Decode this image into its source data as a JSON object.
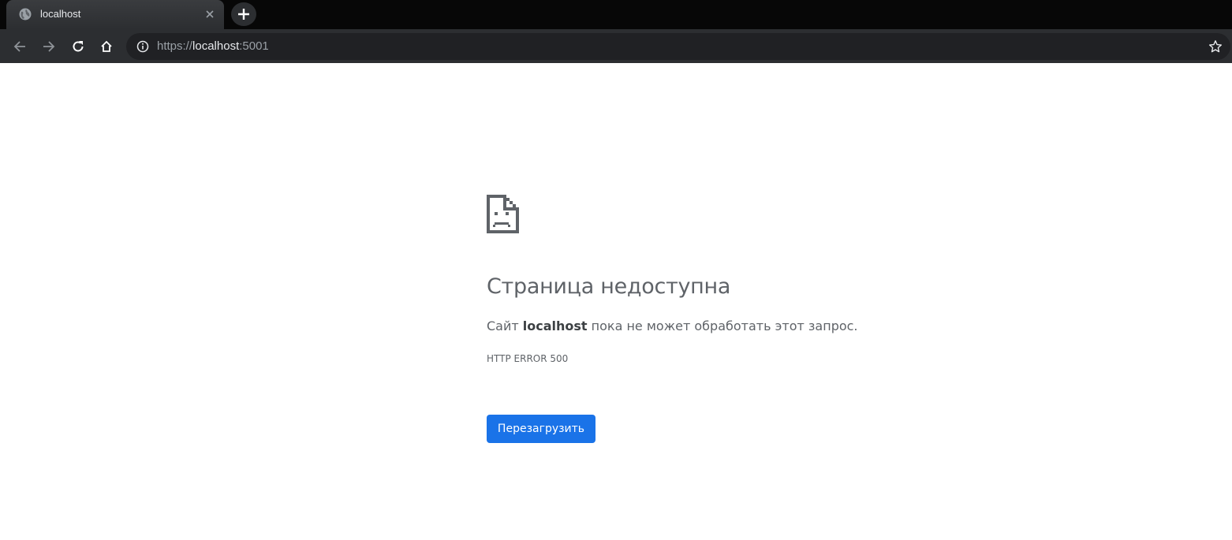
{
  "browser": {
    "tab": {
      "title": "localhost",
      "favicon": "globe-icon",
      "close": "close-icon"
    },
    "new_tab": "plus-icon",
    "toolbar": {
      "back": "arrow-left-icon",
      "forward": "arrow-right-icon",
      "reload": "reload-icon",
      "home": "home-icon"
    },
    "omnibox": {
      "security_icon": "info-icon",
      "url_scheme": "https://",
      "url_host": "localhost",
      "url_port": ":5001",
      "bookmark_icon": "star-outline-icon"
    }
  },
  "error_page": {
    "icon": "sad-page-icon",
    "heading": "Страница недоступна",
    "message_prefix": "Сайт ",
    "message_host": "localhost",
    "message_suffix": " пока не может обработать этот запрос.",
    "error_code": "HTTP ERROR 500",
    "reload_button_label": "Перезагрузить"
  },
  "colors": {
    "tab_strip_bg": "#070707",
    "toolbar_bg": "#2c2e31",
    "omnibox_bg": "#202124",
    "text_primary": "#5f6368",
    "button_bg": "#1a73e8"
  }
}
